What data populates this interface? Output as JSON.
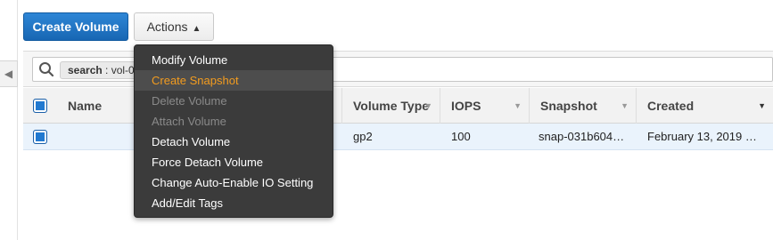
{
  "toolbar": {
    "create_label": "Create Volume",
    "actions_label": "Actions",
    "actions_caret": "^"
  },
  "actions_menu": {
    "items": [
      {
        "label": "Modify Volume",
        "state": "enabled"
      },
      {
        "label": "Create Snapshot",
        "state": "highlighted"
      },
      {
        "label": "Delete Volume",
        "state": "disabled"
      },
      {
        "label": "Attach Volume",
        "state": "disabled"
      },
      {
        "label": "Detach Volume",
        "state": "enabled"
      },
      {
        "label": "Force Detach Volume",
        "state": "enabled"
      },
      {
        "label": "Change Auto-Enable IO Setting",
        "state": "enabled"
      },
      {
        "label": "Add/Edit Tags",
        "state": "enabled"
      }
    ]
  },
  "search": {
    "token_key": "search",
    "token_value": " : vol-0"
  },
  "table": {
    "columns": [
      "Name",
      "Volume Type",
      "IOPS",
      "Snapshot",
      "Created"
    ],
    "rows": [
      {
        "name": "",
        "volume_type": "gp2",
        "iops": "100",
        "snapshot": "snap-031b604…",
        "created": "February 13, 2019 …",
        "selected": true
      }
    ]
  },
  "icons": {
    "collapse": "chevron-left-icon",
    "search": "search-icon",
    "sort": "sort-caret-icon"
  },
  "colors": {
    "primary": "#1b74c5",
    "menu_bg": "#3b3b3b",
    "menu_highlight": "#f39c1f",
    "selected_row": "#eaf3fc"
  }
}
